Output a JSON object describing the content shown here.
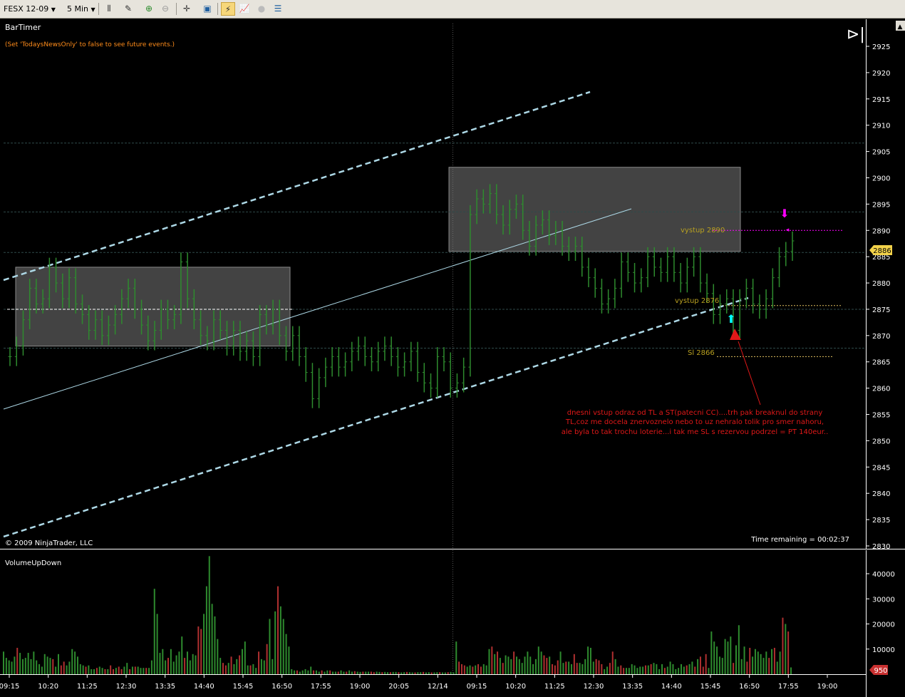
{
  "toolbar": {
    "instrument": "FESX 12-09",
    "interval": "5 Min"
  },
  "price_panel": {
    "indicator_name": "BarTimer",
    "news_note": "(Set 'TodaysNewsOnly' to false to see future events.)",
    "copyright": "© 2009 NinjaTrader, LLC",
    "time_remaining": "Time remaining = 00:02:37",
    "current_price_tag": "2886",
    "annotations": {
      "exit": "vystup 2890",
      "entry": "vystup 2876",
      "stop": "Sl 2866",
      "comment_lines": [
        "dnesni vstup odraz od TL a ST(patecni CC)....trh pak breaknul do strany",
        "TL,coz me docela znervoznelo nebo to uz nehralo tolik pro smer nahoru,",
        "ale byla to tak trochu loterie...i tak me SL s rezervou podrzel = PT 140eur.."
      ]
    },
    "colors": {
      "background": "#000000",
      "candle": "#2e8b2e",
      "trendline": "#add8e6",
      "annotation_text": "#b8a020",
      "comment_text": "#e01818",
      "exit_marker": "#ff00ff",
      "entry_marker": "#00ffff",
      "price_tag": "#f2d24a"
    }
  },
  "volume_panel": {
    "indicator_name": "VolumeUpDown",
    "current_volume_tag": "950",
    "colors": {
      "up": "#2e8b2e",
      "down": "#b03030",
      "tag": "#c83030"
    }
  },
  "chart_data": [
    {
      "type": "bar",
      "subtype": "ohlc",
      "title": "FESX 12-09 5 Min",
      "x_tick_labels": [
        "09:15",
        "10:20",
        "11:25",
        "12:30",
        "13:35",
        "14:40",
        "15:45",
        "16:50",
        "17:55",
        "19:00",
        "20:05",
        "12/14",
        "09:15",
        "10:20",
        "11:25",
        "12:30",
        "13:35",
        "14:40",
        "15:45",
        "16:50",
        "17:55",
        "19:00"
      ],
      "y_tick_labels": [
        "2925",
        "2920",
        "2915",
        "2910",
        "2905",
        "2900",
        "2895",
        "2890",
        "2885",
        "2880",
        "2875",
        "2870",
        "2865",
        "2860",
        "2855",
        "2850",
        "2845",
        "2840",
        "2835",
        "2830"
      ],
      "ylim": [
        2830,
        2926
      ],
      "grid": false,
      "series": [
        {
          "values": [
            2866,
            2868,
            2873,
            2879,
            2876,
            2877,
            2883,
            2880,
            2877,
            2881,
            2876,
            2874,
            2871,
            2873,
            2870,
            2872,
            2874,
            2877,
            2879,
            2875,
            2872,
            2869,
            2871,
            2875,
            2873,
            2874,
            2884,
            2877,
            2873,
            2870,
            2869,
            2873,
            2871,
            2868,
            2871,
            2867,
            2869,
            2866,
            2874,
            2872,
            2875,
            2870,
            2867,
            2870,
            2866,
            2863,
            2858,
            2862,
            2864,
            2866,
            2864,
            2865,
            2867,
            2868,
            2866,
            2865,
            2867,
            2868,
            2866,
            2864,
            2865,
            2867,
            2863,
            2861,
            2860,
            2866,
            2865,
            2860,
            2861,
            2864,
            2893,
            2896,
            2895,
            2897,
            2893,
            2891,
            2894,
            2895,
            2890,
            2887,
            2891,
            2892,
            2889,
            2890,
            2887,
            2886,
            2887,
            2883,
            2881,
            2879,
            2876,
            2877,
            2879,
            2884,
            2882,
            2880,
            2881,
            2885,
            2883,
            2882,
            2885,
            2882,
            2880,
            2883,
            2885,
            2880,
            2878,
            2874,
            2876,
            2877,
            2871,
            2877,
            2879,
            2876,
            2875,
            2877,
            2881,
            2885,
            2886,
            2888
          ],
          "encoding": "approximate close per 5-min bar"
        }
      ],
      "horizontal_lines": [
        2875,
        2866,
        2876,
        2890
      ],
      "zones": [
        {
          "y_range": [
            2868,
            2883
          ]
        },
        {
          "y_range": [
            2886,
            2902
          ]
        }
      ]
    },
    {
      "type": "bar",
      "title": "VolumeUpDown",
      "y_tick_labels": [
        "40000",
        "30000",
        "20000",
        "10000"
      ],
      "ylim": [
        0,
        46000
      ],
      "series": [
        {
          "values": [
            9000,
            6500,
            5500,
            5000,
            7000,
            10500,
            8500,
            6000,
            6500,
            8500,
            6000,
            9000,
            5500,
            4000,
            3000,
            8000,
            7000,
            6500,
            6000,
            3000,
            8000,
            3500,
            5000,
            3500,
            5000,
            10000,
            9000,
            7000,
            4000,
            3500,
            3000,
            3500,
            2000,
            2000,
            2500,
            3000,
            2500,
            2000,
            2000,
            3500,
            2000,
            2500,
            3000,
            2000,
            3000,
            4500,
            2000,
            3000,
            3000,
            3000,
            2500,
            2500,
            2500,
            2500,
            5500,
            34000,
            24000,
            8500,
            10000,
            5500,
            6500,
            10000,
            5000,
            7500,
            9000,
            15000,
            6500,
            9000,
            5500,
            8000,
            7500,
            19000,
            18000,
            24000,
            35000,
            47000,
            28000,
            23000,
            14000,
            6500,
            4500,
            3500,
            4500,
            7000,
            4000,
            6000,
            7500,
            10000,
            13000,
            3500,
            3500,
            4000,
            2500,
            9000,
            6000,
            5500,
            12000,
            22000,
            6000,
            25000,
            35000,
            27000,
            22000,
            16000,
            11000,
            2000,
            1500,
            1500,
            1000,
            1500,
            2000,
            1500,
            3000,
            1500,
            1500,
            1000,
            1500,
            1000,
            1500,
            1500,
            1000,
            1000,
            1000,
            1500,
            1000,
            1000,
            1500,
            1000,
            1200,
            1000,
            900,
            1000,
            1000,
            1000,
            1000,
            800,
            1000,
            900,
            800,
            900,
            800,
            800,
            900,
            900,
            800,
            700,
            800,
            900,
            800,
            700,
            700,
            800,
            800,
            900,
            700,
            800,
            700,
            700,
            800,
            800,
            700,
            700,
            800,
            900,
            700,
            13000,
            5000,
            4000,
            3500,
            3000,
            3500,
            3000,
            3500,
            4000,
            3000,
            4000,
            3500,
            10000,
            11000,
            8000,
            9000,
            6500,
            4500,
            7500,
            7000,
            6000,
            9000,
            7000,
            6000,
            4500,
            7000,
            9000,
            7000,
            4000,
            6000,
            11000,
            9000,
            7500,
            6500,
            7000,
            4000,
            3500,
            5500,
            9000,
            4500,
            5000,
            5000,
            4000,
            8000,
            4500,
            4500,
            4000,
            6000,
            11000,
            10500,
            5000,
            6000,
            5500,
            4000,
            2000,
            3000,
            4500,
            9000,
            6000,
            3000,
            3500,
            2500,
            2500,
            2500,
            4000,
            3500,
            2500,
            3000,
            3000,
            3500,
            3500,
            4000,
            4500,
            4000,
            2000,
            4000,
            2500,
            3000,
            5000,
            4000,
            2000,
            2500,
            4000,
            3000,
            3500,
            4000,
            5000,
            3000,
            6000,
            7000,
            3000,
            8000,
            2500,
            17000,
            13000,
            11000,
            7000,
            6500,
            14000,
            13000,
            15000,
            4500,
            11500,
            19500,
            6000,
            11000,
            5000,
            10500,
            7000,
            10000,
            9000,
            8000,
            6500,
            9000,
            6500,
            10000,
            10500,
            5000,
            9000,
            22500,
            20000,
            17000,
            2700
          ]
        }
      ]
    }
  ]
}
